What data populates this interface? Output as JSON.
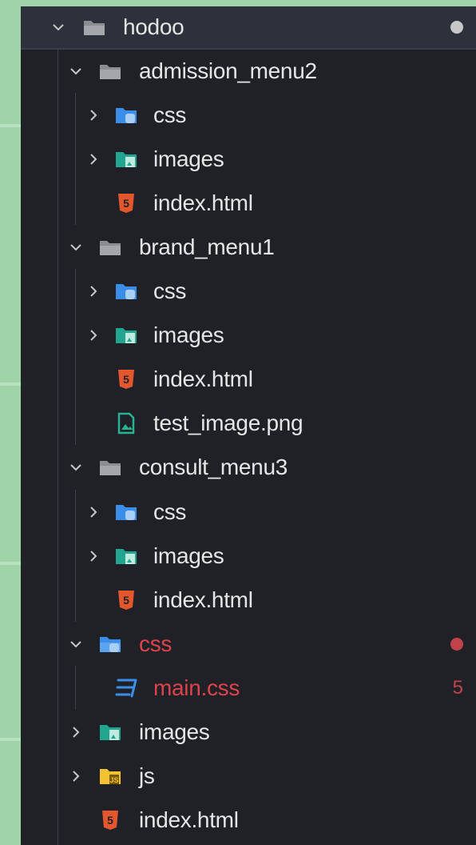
{
  "explorer": {
    "root": {
      "label": "hodoo"
    },
    "folders": {
      "admission": {
        "label": "admission_menu2",
        "css": "css",
        "images": "images",
        "index": "index.html"
      },
      "brand": {
        "label": "brand_menu1",
        "css": "css",
        "images": "images",
        "index": "index.html",
        "png": "test_image.png"
      },
      "consult": {
        "label": "consult_menu3",
        "css": "css",
        "images": "images",
        "index": "index.html"
      },
      "css": {
        "label": "css",
        "main": "main.css",
        "problems": "5"
      },
      "images": {
        "label": "images"
      },
      "js": {
        "label": "js"
      }
    },
    "root_index": "index.html"
  },
  "colors": {
    "error": "#e0424b",
    "modified_dot": "#c7c7c7",
    "folder_css": "#3b8ee8",
    "folder_images": "#22a58f",
    "folder_js": "#f1c232",
    "html_icon": "#e4572e",
    "css_icon": "#3b8ee8",
    "png_icon": "#27b292"
  }
}
